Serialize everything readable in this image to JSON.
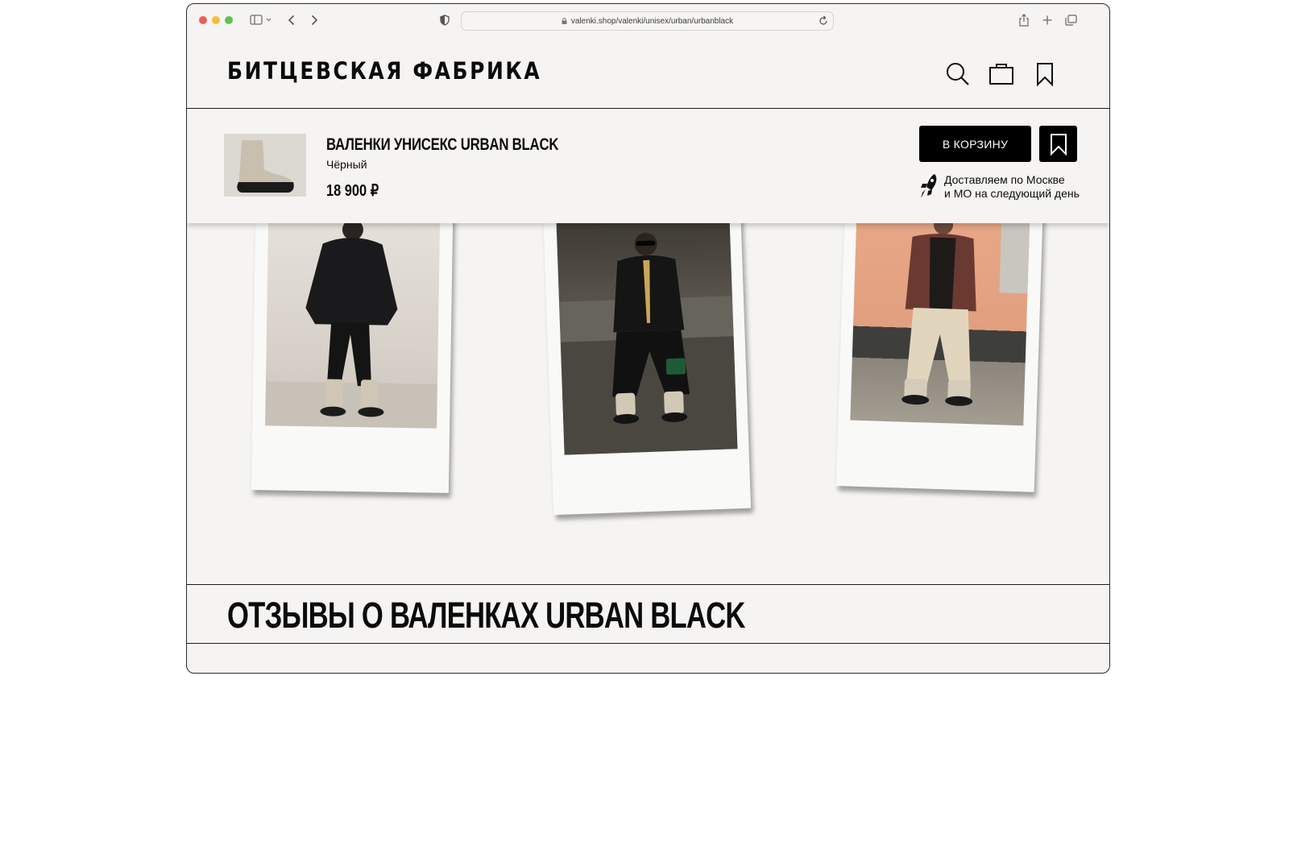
{
  "browser": {
    "url": "valenki.shop/valenki/unisex/urban/urbanblack"
  },
  "site": {
    "logo": "БИТЦЕВСКАЯ ФАБРИКА"
  },
  "header_icons": [
    "search-icon",
    "shopping-bag-icon",
    "bookmark-icon"
  ],
  "product": {
    "name": "ВАЛЕНКИ УНИСЕКС URBAN BLACK",
    "color": "Чёрный",
    "price": "18 900 ₽",
    "cart_button": "В КОРЗИНУ",
    "delivery_line1": "Доставляем по Москве",
    "delivery_line2": "и МО на следующий день"
  },
  "gallery": {
    "photos": [
      "woman-black-puffer-photo",
      "woman-leather-jacket-photo",
      "man-plaid-jacket-photo"
    ]
  },
  "reviews": {
    "title": "ОТЗЫВЫ О ВАЛЕНКАХ URBAN BLACK"
  },
  "colors": {
    "page_bg": "#f5f4f2",
    "accent": "#000000"
  }
}
